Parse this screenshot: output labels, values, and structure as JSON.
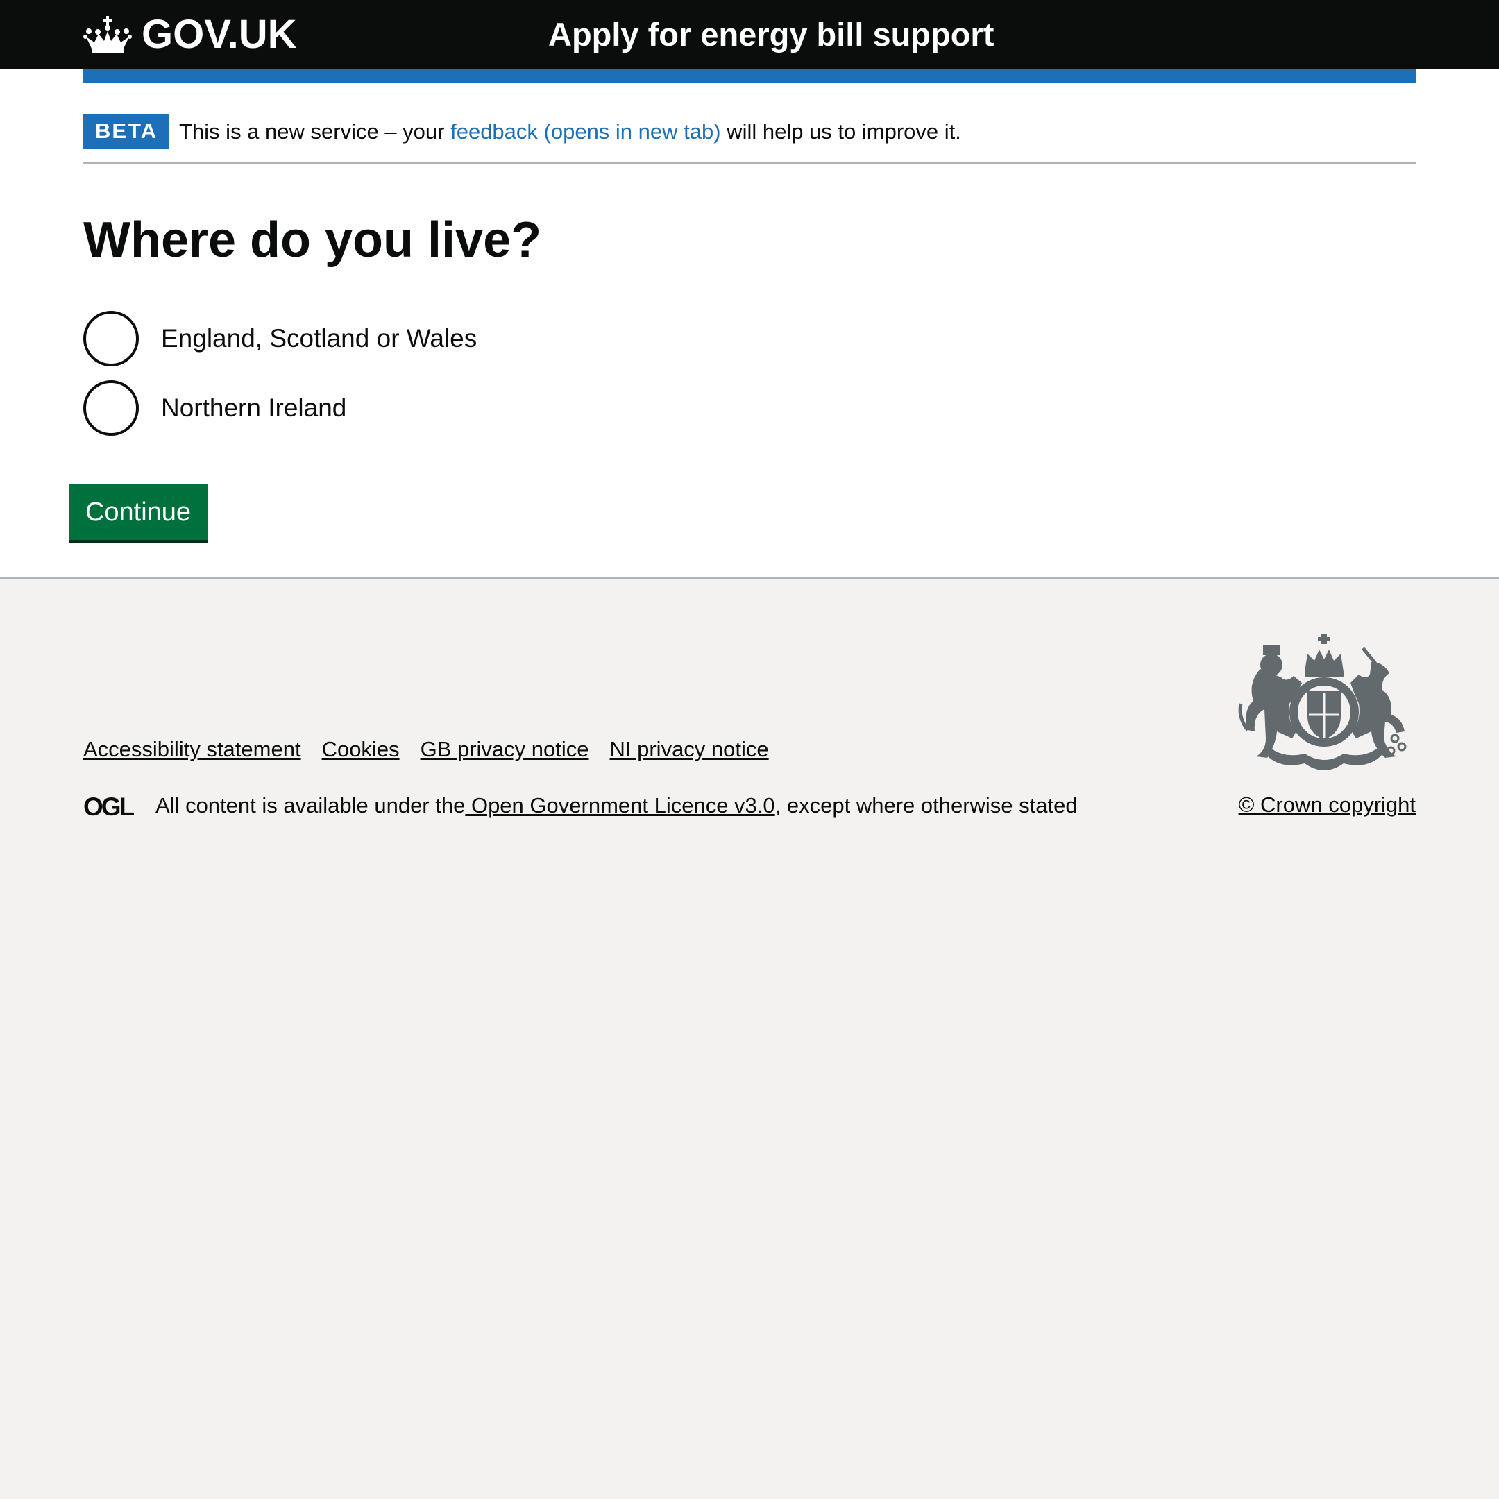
{
  "header": {
    "logo_text": "GOV.UK",
    "service_name": "Apply for energy bill support"
  },
  "phase_banner": {
    "tag": "BETA",
    "text_before": "This is a new service – your ",
    "link_text": "feedback (opens in new tab)",
    "text_after": " will help us to improve it."
  },
  "question": {
    "title": "Where do you live?",
    "options": [
      {
        "label": "England, Scotland or Wales",
        "selected": false
      },
      {
        "label": "Northern Ireland",
        "selected": false
      }
    ]
  },
  "actions": {
    "continue_label": "Continue"
  },
  "footer": {
    "links": [
      "Accessibility statement",
      "Cookies",
      "GB privacy notice",
      "NI privacy notice"
    ],
    "licence_before": "All content is available under the",
    "licence_link": " Open Government Licence v3.0",
    "licence_after": ", except where otherwise stated",
    "copyright": "© Crown copyright",
    "ogl_logo_text": "OGL"
  },
  "colors": {
    "header_bg": "#0b0c0c",
    "brand_blue": "#1d70b8",
    "button_green": "#00703c",
    "footer_bg": "#f3f2f1",
    "crest": "#626a6e"
  },
  "icons": {
    "logo": "crown-icon",
    "licence": "ogl-logo-icon",
    "crest": "royal-coat-of-arms-icon"
  }
}
